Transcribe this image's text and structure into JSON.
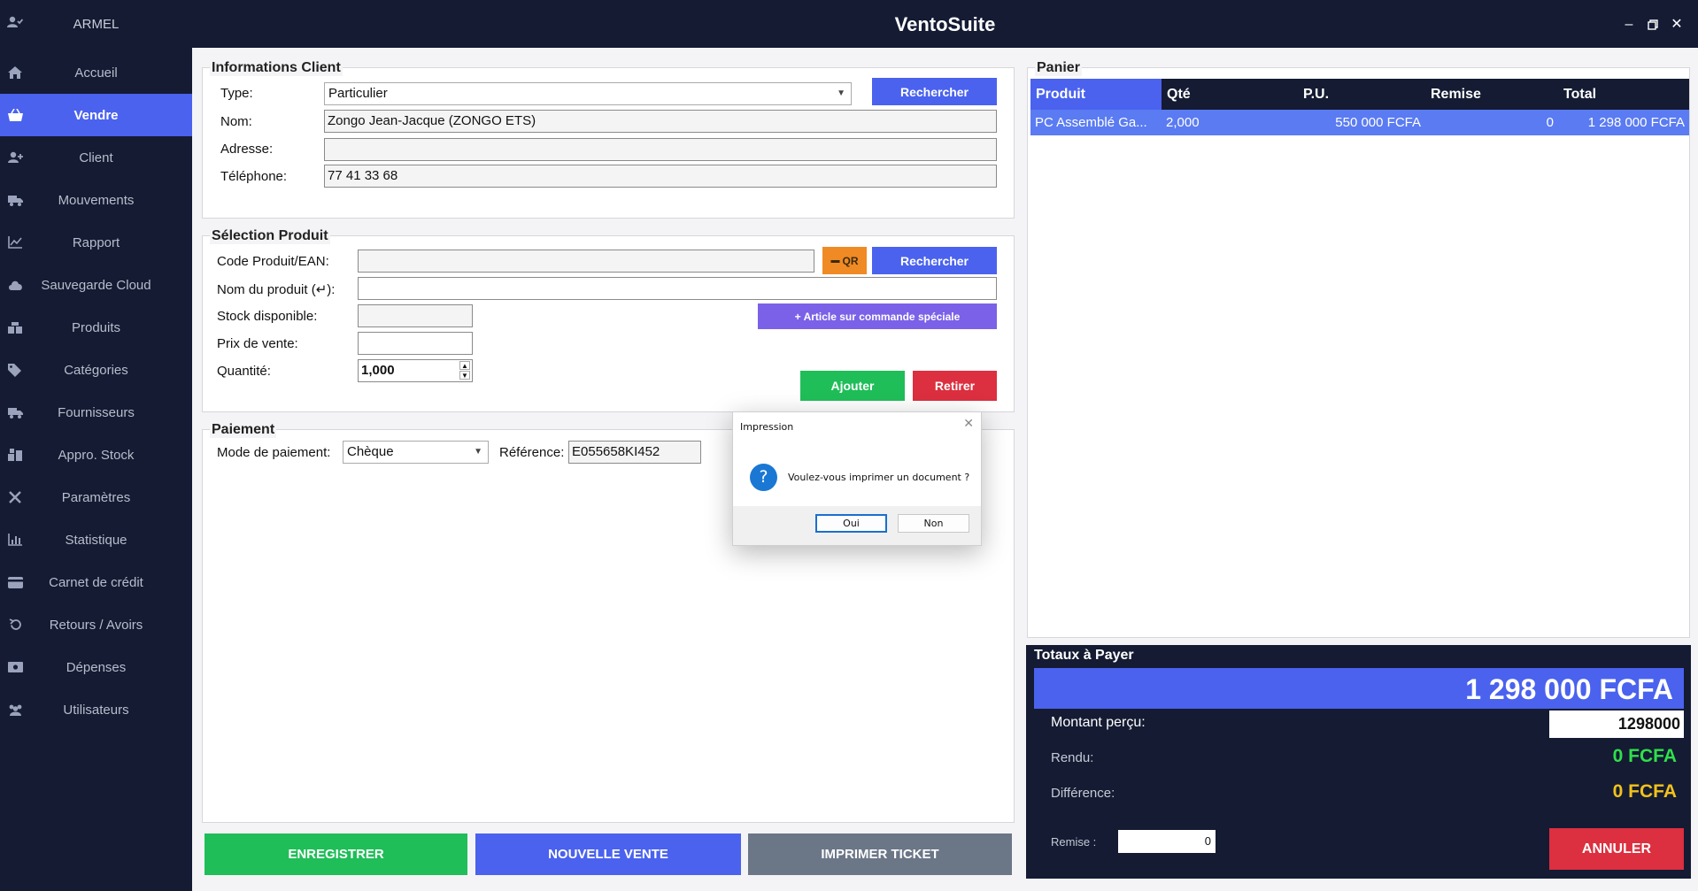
{
  "app": {
    "title": "VentoSuite"
  },
  "sidebar": {
    "user": "ARMEL",
    "items": [
      {
        "label": "Accueil",
        "icon": "home-icon",
        "active": false
      },
      {
        "label": "Vendre",
        "icon": "basket-icon",
        "active": true
      },
      {
        "label": "Client",
        "icon": "user-plus-icon",
        "active": false
      },
      {
        "label": "Mouvements",
        "icon": "truck-icon",
        "active": false
      },
      {
        "label": "Rapport",
        "icon": "line-chart-icon",
        "active": false
      },
      {
        "label": "Sauvegarde Cloud",
        "icon": "cloud-icon",
        "active": false
      },
      {
        "label": "Produits",
        "icon": "boxes-icon",
        "active": false
      },
      {
        "label": "Catégories",
        "icon": "tags-icon",
        "active": false
      },
      {
        "label": "Fournisseurs",
        "icon": "truck-icon",
        "active": false
      },
      {
        "label": "Appro. Stock",
        "icon": "warehouse-icon",
        "active": false
      },
      {
        "label": "Paramètres",
        "icon": "tools-icon",
        "active": false
      },
      {
        "label": "Statistique",
        "icon": "bar-chart-icon",
        "active": false
      },
      {
        "label": "Carnet de crédit",
        "icon": "credit-card-icon",
        "active": false
      },
      {
        "label": "Retours / Avoirs",
        "icon": "undo-icon",
        "active": false
      },
      {
        "label": "Dépenses",
        "icon": "money-icon",
        "active": false
      },
      {
        "label": "Utilisateurs",
        "icon": "users-icon",
        "active": false
      }
    ]
  },
  "client": {
    "title": "Informations Client",
    "type_label": "Type:",
    "type_value": "Particulier",
    "search_button": "Rechercher",
    "name_label": "Nom:",
    "name_value": "Zongo Jean-Jacque (ZONGO ETS)",
    "address_label": "Adresse:",
    "address_value": "",
    "phone_label": "Téléphone:",
    "phone_value": "77 41 33 68"
  },
  "product": {
    "title": "Sélection Produit",
    "code_label": "Code Produit/EAN:",
    "code_value": "",
    "qr_button": "QR",
    "search_button": "Rechercher",
    "name_label": "Nom du produit (↵):",
    "name_value": "",
    "special_button": "+ Article sur commande spéciale",
    "stock_label": "Stock disponible:",
    "stock_value": "",
    "price_label": "Prix de vente:",
    "price_value": "",
    "qty_label": "Quantité:",
    "qty_value": "1,000",
    "add_button": "Ajouter",
    "remove_button": "Retirer"
  },
  "payment": {
    "title": "Paiement",
    "mode_label": "Mode de paiement:",
    "mode_value": "Chèque",
    "ref_label": "Référence:",
    "ref_value": "E055658KI452"
  },
  "actions": {
    "save": "ENREGISTRER",
    "new_sale": "NOUVELLE VENTE",
    "print_ticket": "IMPRIMER TICKET"
  },
  "cart": {
    "title": "Panier",
    "columns": [
      "Produit",
      "Qté",
      "P.U.",
      "Remise",
      "Total"
    ],
    "rows": [
      {
        "product": "PC Assemblé Ga...",
        "qty": "2,000",
        "unit_price": "550 000 FCFA",
        "discount": "0",
        "total": "1 298 000 FCFA"
      }
    ]
  },
  "totals": {
    "title": "Totaux à Payer",
    "grand_total": "1 298 000 FCFA",
    "received_label": "Montant perçu:",
    "received_value": "1298000",
    "change_label": "Rendu:",
    "change_value": "0 FCFA",
    "difference_label": "Différence:",
    "difference_value": "0 FCFA",
    "discount_label": "Remise :",
    "discount_value": "0",
    "cancel_button": "ANNULER"
  },
  "dialog": {
    "title": "Impression",
    "message": "Voulez-vous imprimer un document ?",
    "yes": "Oui",
    "no": "Non"
  },
  "colors": {
    "navy": "#141b33",
    "accent_blue": "#4a62ee",
    "green": "#1fbe58",
    "red": "#dc2f3f",
    "orange": "#f08a24",
    "purple": "#7b61e8",
    "gray_button": "#6b7687",
    "cart_row": "#5a7bf2",
    "change_green": "#2fe04a",
    "difference_yellow": "#f2c21b"
  }
}
